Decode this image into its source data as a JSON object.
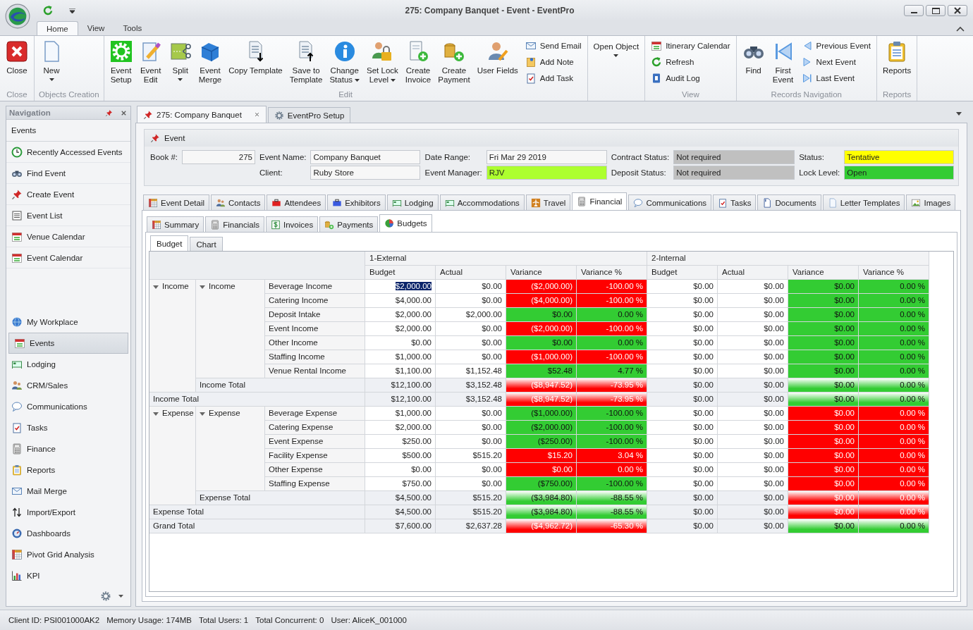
{
  "window": {
    "title": "275: Company Banquet - Event - EventPro"
  },
  "ribbon": {
    "tabs": [
      {
        "label": "Home",
        "selected": true
      },
      {
        "label": "View",
        "selected": false
      },
      {
        "label": "Tools",
        "selected": false
      }
    ],
    "groups": [
      {
        "label": "Close",
        "items": [
          {
            "label": "Close",
            "kind": "large",
            "dropdown": false
          }
        ]
      },
      {
        "label": "Objects Creation",
        "items": [
          {
            "label": "New",
            "kind": "large",
            "dropdown": true
          }
        ]
      },
      {
        "label": "Edit",
        "items": [
          {
            "label": "Event\nSetup",
            "kind": "large",
            "dropdown": false
          },
          {
            "label": "Event\nEdit",
            "kind": "large",
            "dropdown": false
          },
          {
            "label": "Split",
            "kind": "large",
            "dropdown": true
          },
          {
            "label": "Event\nMerge",
            "kind": "large",
            "dropdown": false
          },
          {
            "label": "Copy Template",
            "kind": "large",
            "dropdown": false
          },
          {
            "label": "Save to\nTemplate",
            "kind": "large",
            "dropdown": false
          },
          {
            "label": "Change\nStatus",
            "kind": "large",
            "dropdown": true
          },
          {
            "label": "Set Lock\nLevel",
            "kind": "large",
            "dropdown": true
          },
          {
            "label": "Create\nInvoice",
            "kind": "large",
            "dropdown": false
          },
          {
            "label": "Create\nPayment",
            "kind": "large",
            "dropdown": false
          },
          {
            "label": "User Fields",
            "kind": "large",
            "dropdown": false
          },
          {
            "label": "Send Email",
            "kind": "small",
            "dropdown": false
          },
          {
            "label": "Add Note",
            "kind": "small",
            "dropdown": false
          },
          {
            "label": "Add Task",
            "kind": "small",
            "dropdown": false
          }
        ]
      },
      {
        "items": [
          {
            "label": "Open Object",
            "kind": "large",
            "dropdown": true
          }
        ]
      },
      {
        "label": "View",
        "items": [
          {
            "label": "Itinerary Calendar",
            "kind": "small",
            "dropdown": false
          },
          {
            "label": "Refresh",
            "kind": "small",
            "dropdown": false
          },
          {
            "label": "Audit Log",
            "kind": "small",
            "dropdown": false
          }
        ]
      },
      {
        "label": "Records Navigation",
        "items": [
          {
            "label": "Find",
            "kind": "large",
            "dropdown": false
          },
          {
            "label": "First\nEvent",
            "kind": "large",
            "dropdown": false
          },
          {
            "label": "Previous Event",
            "kind": "small",
            "dropdown": false
          },
          {
            "label": "Next Event",
            "kind": "small",
            "dropdown": false
          },
          {
            "label": "Last Event",
            "kind": "small",
            "dropdown": false
          }
        ]
      },
      {
        "label": "Reports",
        "items": [
          {
            "label": "Reports",
            "kind": "large",
            "dropdown": false
          }
        ]
      }
    ]
  },
  "navigation": {
    "title": "Navigation",
    "section": "Events",
    "actions": [
      {
        "label": "Recently Accessed Events"
      },
      {
        "label": "Find Event"
      },
      {
        "label": "Create Event"
      },
      {
        "label": "Event List"
      },
      {
        "label": "Venue Calendar"
      },
      {
        "label": "Event Calendar"
      }
    ],
    "modules": [
      {
        "label": "My Workplace",
        "selected": false
      },
      {
        "label": "Events",
        "selected": true
      },
      {
        "label": "Lodging",
        "selected": false
      },
      {
        "label": "CRM/Sales",
        "selected": false
      },
      {
        "label": "Communications",
        "selected": false
      },
      {
        "label": "Tasks",
        "selected": false
      },
      {
        "label": "Finance",
        "selected": false
      },
      {
        "label": "Reports",
        "selected": false
      },
      {
        "label": "Mail Merge",
        "selected": false
      },
      {
        "label": "Import/Export",
        "selected": false
      },
      {
        "label": "Dashboards",
        "selected": false
      },
      {
        "label": "Pivot Grid Analysis",
        "selected": false
      },
      {
        "label": "KPI",
        "selected": false
      }
    ]
  },
  "document_tabs": [
    {
      "label": "275: Company Banquet",
      "selected": true
    },
    {
      "label": "EventPro Setup",
      "selected": false
    }
  ],
  "event": {
    "title": "Event",
    "columns": [
      [
        {
          "label": "Book #:",
          "value": "275",
          "color": "#f7f7f7"
        }
      ],
      [
        {
          "label": "Event Name:",
          "value": "Company Banquet",
          "color": "#f7f7f7"
        },
        {
          "label": "Client:",
          "value": "Ruby Store",
          "color": "#f7f7f7"
        }
      ],
      [
        {
          "label": "Date Range:",
          "value": "Fri Mar 29 2019",
          "color": "#f7f7f7"
        },
        {
          "label": "Event Manager:",
          "value": "RJV",
          "color": "#adff2f"
        }
      ],
      [
        {
          "label": "Contract Status:",
          "value": "Not required",
          "color": "#c0c0c0"
        },
        {
          "label": "Deposit Status:",
          "value": "Not required",
          "color": "#c0c0c0"
        }
      ],
      [
        {
          "label": "Status:",
          "value": "Tentative",
          "color": "#ffff00"
        },
        {
          "label": "Lock Level:",
          "value": "Open",
          "color": "#33cc33"
        }
      ]
    ]
  },
  "tabs": [
    {
      "label": "Event Detail",
      "selected": false
    },
    {
      "label": "Contacts",
      "selected": false
    },
    {
      "label": "Attendees",
      "selected": false
    },
    {
      "label": "Exhibitors",
      "selected": false
    },
    {
      "label": "Lodging",
      "selected": false
    },
    {
      "label": "Accommodations",
      "selected": false
    },
    {
      "label": "Travel",
      "selected": false
    },
    {
      "label": "Financial",
      "selected": true
    },
    {
      "label": "Communications",
      "selected": false
    },
    {
      "label": "Tasks",
      "selected": false
    },
    {
      "label": "Documents",
      "selected": false
    },
    {
      "label": "Letter Templates",
      "selected": false
    },
    {
      "label": "Images",
      "selected": false
    }
  ],
  "financial_tabs": [
    {
      "label": "Summary",
      "selected": false
    },
    {
      "label": "Financials",
      "selected": false
    },
    {
      "label": "Invoices",
      "selected": false
    },
    {
      "label": "Payments",
      "selected": false
    },
    {
      "label": "Budgets",
      "selected": true
    }
  ],
  "budget_tabs": [
    {
      "label": "Budget",
      "selected": true
    },
    {
      "label": "Chart",
      "selected": false
    }
  ],
  "pivot": {
    "column_groups": [
      {
        "label": "1-External",
        "measures": [
          "Budget",
          "Actual",
          "Variance",
          "Variance %"
        ]
      },
      {
        "label": "2-Internal",
        "measures": [
          "Budget",
          "Actual",
          "Variance",
          "Variance %"
        ]
      }
    ],
    "groups": [
      {
        "label": "Income",
        "expanded": true,
        "subgroups": [
          {
            "label": "Income",
            "expanded": true,
            "items": [
              {
                "label": "Beverage Income",
                "values": [
                  "$2,000.00",
                  "$0.00",
                  "($2,000.00)",
                  "-100.00 %",
                  "$0.00",
                  "$0.00",
                  "$0.00",
                  "0.00 %"
                ],
                "external": {
                  "color": "#ff0000"
                },
                "internal": {
                  "color": "#33cc33"
                },
                "selected": true
              },
              {
                "label": "Catering Income",
                "values": [
                  "$4,000.00",
                  "$0.00",
                  "($4,000.00)",
                  "-100.00 %",
                  "$0.00",
                  "$0.00",
                  "$0.00",
                  "0.00 %"
                ],
                "external": {
                  "color": "#ff0000"
                },
                "internal": {
                  "color": "#33cc33"
                },
                "selected": false
              },
              {
                "label": "Deposit Intake",
                "values": [
                  "$2,000.00",
                  "$2,000.00",
                  "$0.00",
                  "0.00 %",
                  "$0.00",
                  "$0.00",
                  "$0.00",
                  "0.00 %"
                ],
                "external": {
                  "color": "#33cc33"
                },
                "internal": {
                  "color": "#33cc33"
                },
                "selected": false
              },
              {
                "label": "Event Income",
                "values": [
                  "$2,000.00",
                  "$0.00",
                  "($2,000.00)",
                  "-100.00 %",
                  "$0.00",
                  "$0.00",
                  "$0.00",
                  "0.00 %"
                ],
                "external": {
                  "color": "#ff0000"
                },
                "internal": {
                  "color": "#33cc33"
                },
                "selected": false
              },
              {
                "label": "Other Income",
                "values": [
                  "$0.00",
                  "$0.00",
                  "$0.00",
                  "0.00 %",
                  "$0.00",
                  "$0.00",
                  "$0.00",
                  "0.00 %"
                ],
                "external": {
                  "color": "#33cc33"
                },
                "internal": {
                  "color": "#33cc33"
                },
                "selected": false
              },
              {
                "label": "Staffing Income",
                "values": [
                  "$1,000.00",
                  "$0.00",
                  "($1,000.00)",
                  "-100.00 %",
                  "$0.00",
                  "$0.00",
                  "$0.00",
                  "0.00 %"
                ],
                "external": {
                  "color": "#ff0000"
                },
                "internal": {
                  "color": "#33cc33"
                },
                "selected": false
              },
              {
                "label": "Venue Rental Income",
                "values": [
                  "$1,100.00",
                  "$1,152.48",
                  "$52.48",
                  "4.77 %",
                  "$0.00",
                  "$0.00",
                  "$0.00",
                  "0.00 %"
                ],
                "external": {
                  "color": "#33cc33"
                },
                "internal": {
                  "color": "#33cc33"
                },
                "selected": false
              }
            ],
            "total": {
              "label": "Income Total",
              "values": [
                "$12,100.00",
                "$3,152.48",
                "($8,947.52)",
                "-73.95 %",
                "$0.00",
                "$0.00",
                "$0.00",
                "0.00 %"
              ],
              "external": {
                "color": "#ff0000"
              },
              "internal": {
                "color": "#33cc33"
              }
            }
          }
        ],
        "total": {
          "label": "Income Total",
          "values": [
            "$12,100.00",
            "$3,152.48",
            "($8,947.52)",
            "-73.95 %",
            "$0.00",
            "$0.00",
            "$0.00",
            "0.00 %"
          ],
          "external": {
            "color": "#ff0000"
          },
          "internal": {
            "color": "#33cc33"
          }
        }
      },
      {
        "label": "Expense",
        "expanded": true,
        "subgroups": [
          {
            "label": "Expense",
            "expanded": true,
            "items": [
              {
                "label": "Beverage Expense",
                "values": [
                  "$1,000.00",
                  "$0.00",
                  "($1,000.00)",
                  "-100.00 %",
                  "$0.00",
                  "$0.00",
                  "$0.00",
                  "0.00 %"
                ],
                "external": {
                  "color": "#33cc33"
                },
                "internal": {
                  "color": "#ff0000"
                },
                "selected": false
              },
              {
                "label": "Catering Expense",
                "values": [
                  "$2,000.00",
                  "$0.00",
                  "($2,000.00)",
                  "-100.00 %",
                  "$0.00",
                  "$0.00",
                  "$0.00",
                  "0.00 %"
                ],
                "external": {
                  "color": "#33cc33"
                },
                "internal": {
                  "color": "#ff0000"
                },
                "selected": false
              },
              {
                "label": "Event Expense",
                "values": [
                  "$250.00",
                  "$0.00",
                  "($250.00)",
                  "-100.00 %",
                  "$0.00",
                  "$0.00",
                  "$0.00",
                  "0.00 %"
                ],
                "external": {
                  "color": "#33cc33"
                },
                "internal": {
                  "color": "#ff0000"
                },
                "selected": false
              },
              {
                "label": "Facility Expense",
                "values": [
                  "$500.00",
                  "$515.20",
                  "$15.20",
                  "3.04 %",
                  "$0.00",
                  "$0.00",
                  "$0.00",
                  "0.00 %"
                ],
                "external": {
                  "color": "#ff0000"
                },
                "internal": {
                  "color": "#ff0000"
                },
                "selected": false
              },
              {
                "label": "Other Expense",
                "values": [
                  "$0.00",
                  "$0.00",
                  "$0.00",
                  "0.00 %",
                  "$0.00",
                  "$0.00",
                  "$0.00",
                  "0.00 %"
                ],
                "external": {
                  "color": "#ff0000"
                },
                "internal": {
                  "color": "#ff0000"
                },
                "selected": false
              },
              {
                "label": "Staffing Expense",
                "values": [
                  "$750.00",
                  "$0.00",
                  "($750.00)",
                  "-100.00 %",
                  "$0.00",
                  "$0.00",
                  "$0.00",
                  "0.00 %"
                ],
                "external": {
                  "color": "#33cc33"
                },
                "internal": {
                  "color": "#ff0000"
                },
                "selected": false
              }
            ],
            "total": {
              "label": "Expense Total",
              "values": [
                "$4,500.00",
                "$515.20",
                "($3,984.80)",
                "-88.55 %",
                "$0.00",
                "$0.00",
                "$0.00",
                "0.00 %"
              ],
              "external": {
                "color": "#33cc33"
              },
              "internal": {
                "color": "#ff0000"
              }
            }
          }
        ],
        "total": {
          "label": "Expense Total",
          "values": [
            "$4,500.00",
            "$515.20",
            "($3,984.80)",
            "-88.55 %",
            "$0.00",
            "$0.00",
            "$0.00",
            "0.00 %"
          ],
          "external": {
            "color": "#33cc33"
          },
          "internal": {
            "color": "#ff0000"
          }
        }
      }
    ],
    "grand_total": {
      "label": "Grand Total",
      "values": [
        "$7,600.00",
        "$2,637.28",
        "($4,962.72)",
        "-65.30 %",
        "$0.00",
        "$0.00",
        "$0.00",
        "0.00 %"
      ],
      "external": {
        "color": "#ff0000"
      },
      "internal": {
        "color": "#33cc33"
      }
    }
  },
  "status_bar": [
    "Client ID: PSI001000AK2",
    "Memory Usage: 174MB",
    "Total Users: 1",
    "Total Concurrent: 0",
    "User: AliceK_001000"
  ]
}
